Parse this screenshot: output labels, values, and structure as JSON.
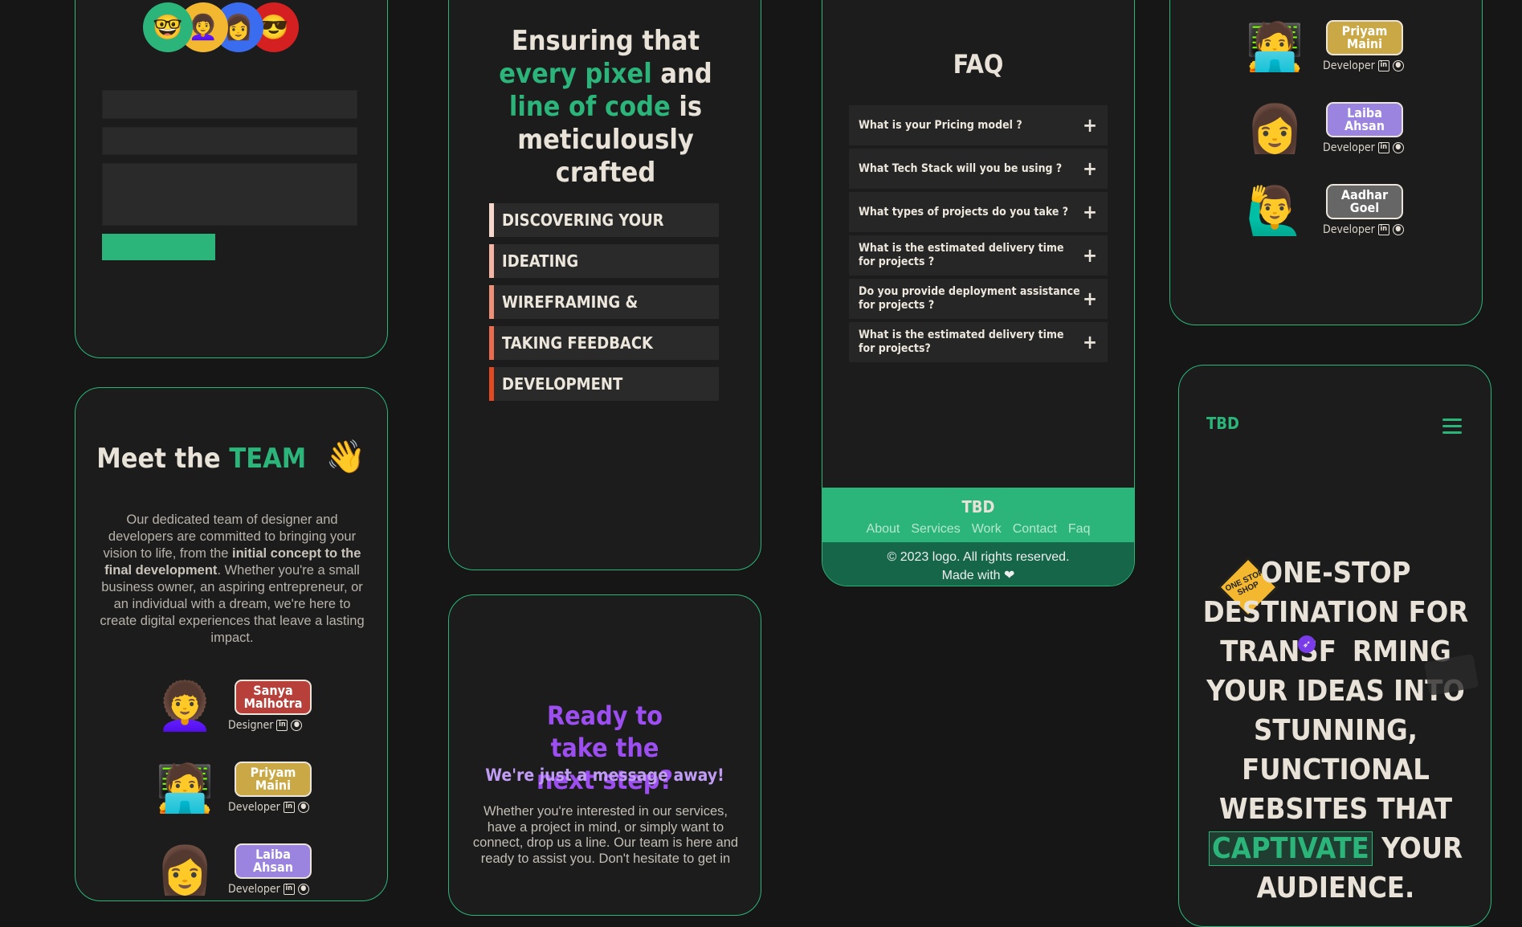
{
  "colors": {
    "accent": "#2bb57a",
    "purple": "#9d4ef0",
    "background": "#161616"
  },
  "contact_card": {
    "avatars": [
      {
        "icon": "memoji-man-glasses-icon",
        "bg": "#2bb57a",
        "glyph": "🤓"
      },
      {
        "icon": "memoji-curly-hair-icon",
        "bg": "#f3b82f",
        "glyph": "👩‍🦱"
      },
      {
        "icon": "memoji-woman-icon",
        "bg": "#3a6cf0",
        "glyph": "👩"
      },
      {
        "icon": "memoji-man-sunglasses-icon",
        "bg": "#d42020",
        "glyph": "😎"
      }
    ]
  },
  "team_card": {
    "title_pre": "Meet the ",
    "title_accent": "TEAM",
    "wave": "👋",
    "desc_1": "Our dedicated team of designer and developers are committed to bringing your vision to life, from the ",
    "desc_bold": "initial concept to the final development",
    "desc_2": ". Whether you're a small business owner, an aspiring entrepreneur, or an individual with a dream, we're here to create digital experiences that leave a lasting impact.",
    "members": [
      {
        "name": "Sanya Malhotra",
        "role": "Designer",
        "color": "#b8403a",
        "glyph": "👩‍🦱"
      },
      {
        "name": "Priyam Maini",
        "role": "Developer",
        "color": "#c9a845",
        "glyph": "🧑‍💻"
      },
      {
        "name": "Laiba Ahsan",
        "role": "Developer",
        "color": "#9b83e0",
        "glyph": "👩"
      }
    ]
  },
  "process_card": {
    "t1": "Ensuring that ",
    "t2": "every pixel",
    "t3": " and ",
    "t4": "line of code",
    "t5": " is meticulously crafted",
    "steps": [
      {
        "label": "DISCOVERING YOUR NEEDS",
        "color": "#f7d6cc"
      },
      {
        "label": "IDEATING",
        "color": "#f3b4a4"
      },
      {
        "label": "WIREFRAMING & PROTOTYPING",
        "color": "#ee9078"
      },
      {
        "label": "TAKING FEEDBACK",
        "color": "#ea6c4e"
      },
      {
        "label": "DEVELOPMENT",
        "color": "#e44a22"
      }
    ]
  },
  "cta_card": {
    "title": "Ready to take the next step?",
    "subtitle": "We're just a message away!",
    "desc": "Whether you're interested in our services, have a project in mind, or simply want to connect, drop us a line. Our team is here and ready to assist you. Don't hesitate to get in"
  },
  "faq_card": {
    "title": "FAQ",
    "items": [
      "What is your Pricing model ?",
      "What Tech Stack will you be using ?",
      "What types of projects do you take ?",
      "What is the estimated delivery time for projects ?",
      "Do you provide deployment assistance for projects ?",
      "What is the estimated delivery time for projects?"
    ],
    "footer_logo": "TBD",
    "footer_links": [
      "About",
      "Services",
      "Work",
      "Contact",
      "Faq"
    ],
    "copyright": "© 2023 logo. All rights reserved.",
    "made_with": "Made with ❤"
  },
  "team2_card": {
    "members": [
      {
        "name": "Priyam Maini",
        "role": "Developer",
        "color": "#c9a845",
        "glyph": "🧑‍💻"
      },
      {
        "name": "Laiba Ahsan",
        "role": "Developer",
        "color": "#9b83e0",
        "glyph": "👩"
      },
      {
        "name": "Aadhar Goel",
        "role": "Developer",
        "color": "#666666",
        "glyph": "🙋‍♂️"
      }
    ]
  },
  "hero_card": {
    "logo": "TBD",
    "sign_text": "ONE STOP SHOP",
    "text_1": "ONE-STOP DESTINATION FOR TRANSF",
    "text_2": "RMING YOUR IDEAS INTO STUNNING, FUNCTIONAL WEBSITES THAT ",
    "highlight": "CAPTIVATE",
    "text_3": " YOUR AUDIENCE."
  }
}
